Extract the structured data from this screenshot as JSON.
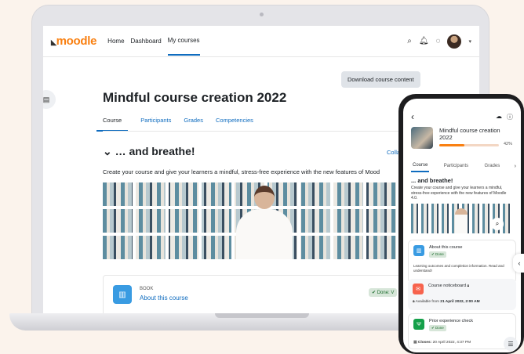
{
  "laptop": {
    "navbar": {
      "logo": "moodle",
      "links": [
        "Home",
        "Dashboard",
        "My courses"
      ],
      "active_link": "My courses"
    },
    "download_button": "Download course content",
    "course_title": "Mindful course creation 2022",
    "tabs": [
      "Course",
      "Participants",
      "Grades",
      "Competencies"
    ],
    "section": {
      "title": "… and breathe!",
      "collapse_label": "Colla",
      "description": "Create your course and give your learners a mindful, stress-free experience with the new features of Mood"
    },
    "activity": {
      "type": "BOOK",
      "name": "About this course",
      "status": "✔ Done: V"
    }
  },
  "phone": {
    "course_title": "Mindful course creation 2022",
    "progress_percent": 42,
    "progress_label": "42%",
    "tabs": [
      "Course",
      "Participants",
      "Grades"
    ],
    "section_title": "... and breathe!",
    "section_description": "Create your course and give your learners a mindful, stress-free experience with the new features of Moodle 4.0.",
    "activities": [
      {
        "name": "About this course",
        "status": "✔ Done",
        "description": "Learning outcomes and completion information. Read and understand!"
      },
      {
        "name": "Course noticeboard",
        "availability_prefix": "Available from ",
        "availability_date": "21 April 2022, 2:00 AM"
      },
      {
        "name": "Prior experience check",
        "status": "✔ Done",
        "closes_label": "Closes:",
        "closes_date": "20 April 2022, 4:37 PM"
      }
    ]
  },
  "colors": {
    "brand": "#f98012",
    "link": "#0f6cbf",
    "book_icon": "#399be2",
    "forum_icon": "#f7634d",
    "feedback_icon": "#15a04a"
  },
  "icons": [
    "search-icon",
    "bell-icon",
    "chat-icon",
    "user-avatar",
    "course-index-icon",
    "cloud-download-icon",
    "info-icon",
    "lock-icon",
    "zoom-icon",
    "list-icon"
  ]
}
